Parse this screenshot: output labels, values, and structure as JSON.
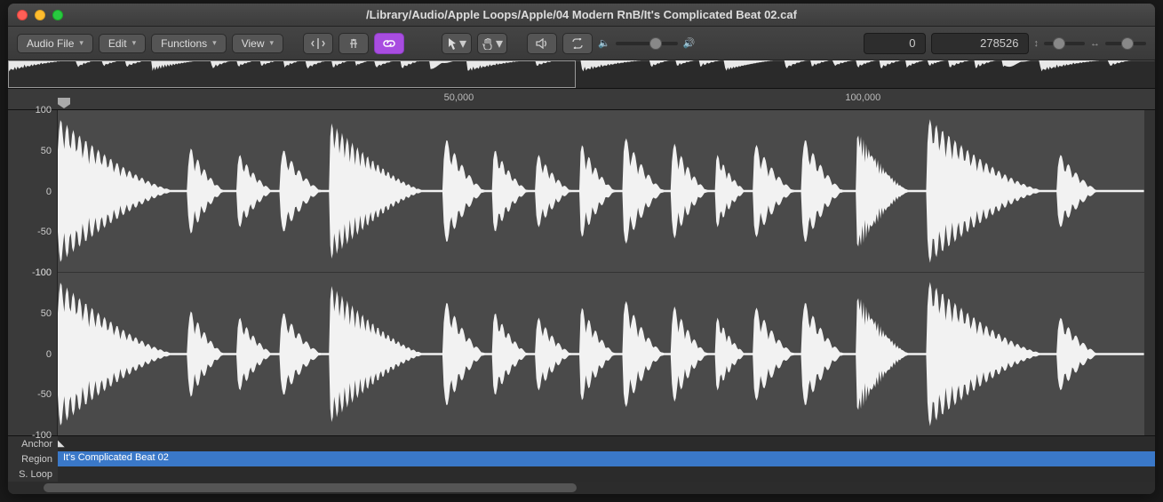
{
  "window": {
    "title": "/Library/Audio/Apple Loops/Apple/04 Modern RnB/It's Complicated Beat 02.caf"
  },
  "toolbar": {
    "menus": {
      "audio_file": "Audio File",
      "edit": "Edit",
      "functions": "Functions",
      "view": "View"
    },
    "readout_left": "0",
    "readout_right": "278526"
  },
  "ruler": {
    "ticks": [
      "50,000",
      "100,000"
    ],
    "tick_positions_pct": [
      38,
      73
    ]
  },
  "overview": {
    "selection_width_pct": 49.5
  },
  "yaxis": {
    "labels": [
      "100",
      "50",
      "0",
      "-50",
      "-100"
    ]
  },
  "footer": {
    "anchor": "Anchor",
    "region": "Region",
    "region_name": "It's Complicated Beat 02",
    "sloop": "S. Loop"
  },
  "waveform": {
    "events": [
      {
        "t": 0.0,
        "a": 1.0,
        "d": 0.11,
        "dense": true
      },
      {
        "t": 0.12,
        "a": 0.65,
        "d": 0.035,
        "dense": false
      },
      {
        "t": 0.165,
        "a": 0.55,
        "d": 0.035,
        "dense": false
      },
      {
        "t": 0.205,
        "a": 0.62,
        "d": 0.04,
        "dense": false
      },
      {
        "t": 0.25,
        "a": 0.95,
        "d": 0.09,
        "dense": true
      },
      {
        "t": 0.355,
        "a": 0.78,
        "d": 0.04,
        "dense": false
      },
      {
        "t": 0.4,
        "a": 0.62,
        "d": 0.035,
        "dense": false
      },
      {
        "t": 0.44,
        "a": 0.55,
        "d": 0.035,
        "dense": false
      },
      {
        "t": 0.48,
        "a": 0.7,
        "d": 0.035,
        "dense": false
      },
      {
        "t": 0.52,
        "a": 0.8,
        "d": 0.04,
        "dense": false
      },
      {
        "t": 0.565,
        "a": 0.72,
        "d": 0.035,
        "dense": false
      },
      {
        "t": 0.605,
        "a": 0.55,
        "d": 0.03,
        "dense": false
      },
      {
        "t": 0.64,
        "a": 0.7,
        "d": 0.04,
        "dense": false
      },
      {
        "t": 0.685,
        "a": 0.78,
        "d": 0.04,
        "dense": false
      },
      {
        "t": 0.735,
        "a": 0.85,
        "d": 0.05,
        "dense": true
      },
      {
        "t": 0.8,
        "a": 1.0,
        "d": 0.11,
        "dense": true
      },
      {
        "t": 0.92,
        "a": 0.55,
        "d": 0.04,
        "dense": false
      }
    ]
  }
}
